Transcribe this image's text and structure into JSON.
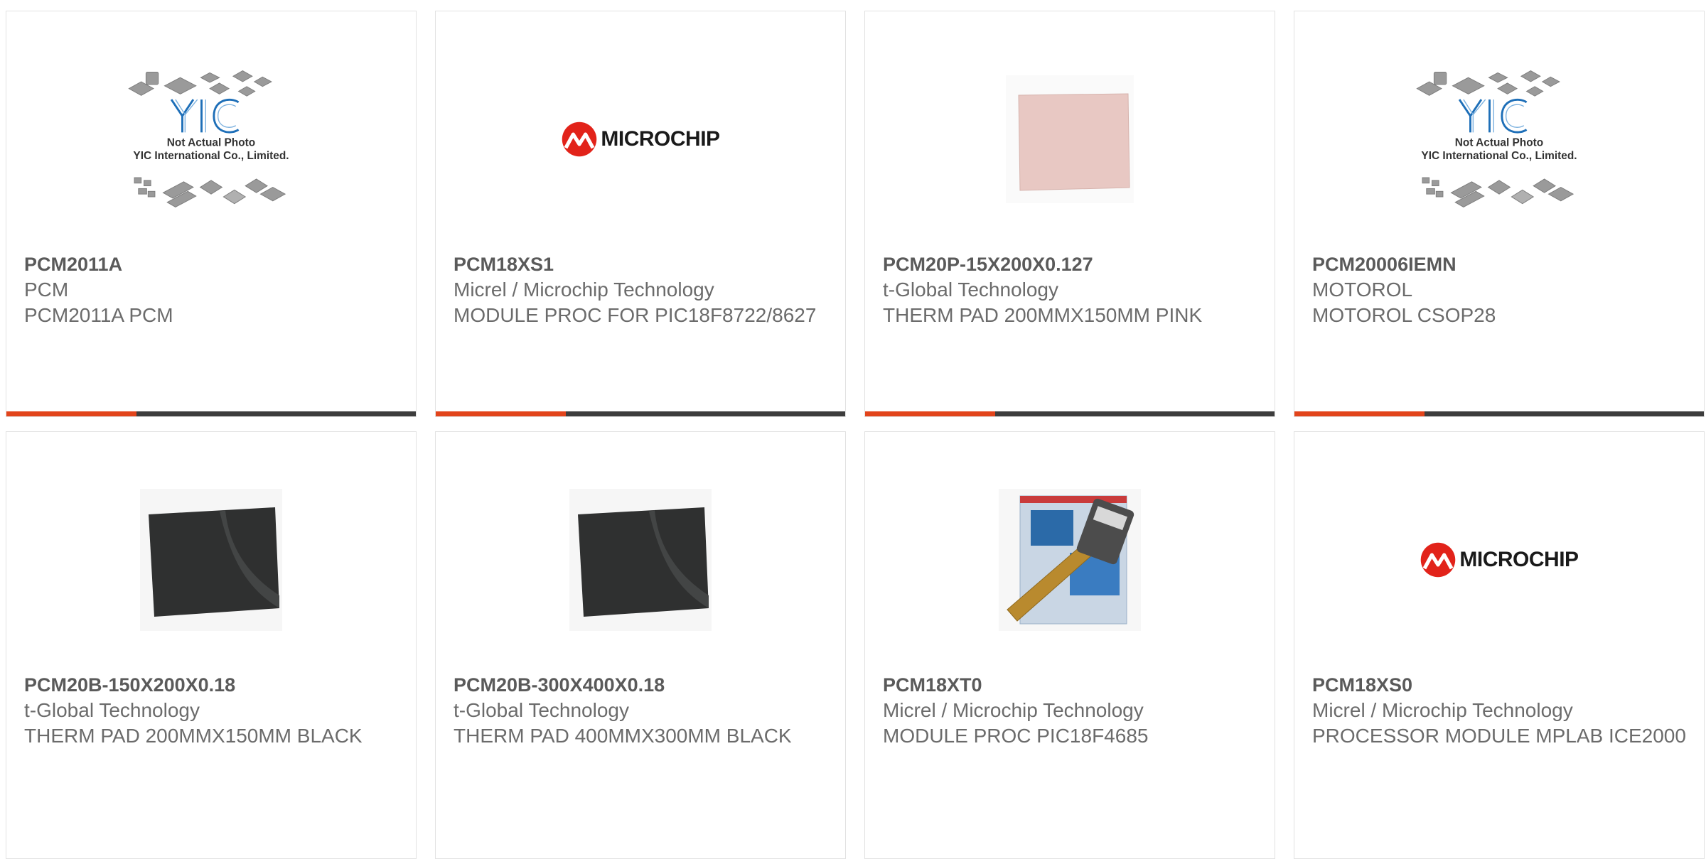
{
  "products": [
    {
      "part_number": "PCM2011A",
      "manufacturer": "PCM",
      "description": "PCM2011A PCM",
      "image": "yic-placeholder",
      "image_caption_1": "Not Actual Photo",
      "image_caption_2": "YIC International Co., Limited."
    },
    {
      "part_number": "PCM18XS1",
      "manufacturer": "Micrel / Microchip Technology",
      "description": "MODULE PROC FOR PIC18F8722/8627",
      "image": "microchip-logo",
      "logo_text": "MICROCHIP"
    },
    {
      "part_number": "PCM20P-15X200X0.127",
      "manufacturer": "t-Global Technology",
      "description": "THERM PAD 200MMX150MM PINK",
      "image": "pink-thermal-pad"
    },
    {
      "part_number": "PCM20006IEMN",
      "manufacturer": "MOTOROL",
      "description": "MOTOROL CSOP28",
      "image": "yic-placeholder",
      "image_caption_1": "Not Actual Photo",
      "image_caption_2": "YIC International Co., Limited."
    },
    {
      "part_number": "PCM20B-150X200X0.18",
      "manufacturer": "t-Global Technology",
      "description": "THERM PAD 200MMX150MM BLACK",
      "image": "black-thermal-pad"
    },
    {
      "part_number": "PCM20B-300X400X0.18",
      "manufacturer": "t-Global Technology",
      "description": "THERM PAD 400MMX300MM BLACK",
      "image": "black-thermal-pad"
    },
    {
      "part_number": "PCM18XT0",
      "manufacturer": "Micrel / Microchip Technology",
      "description": "MODULE PROC PIC18F4685",
      "image": "processor-module-photo"
    },
    {
      "part_number": "PCM18XS0",
      "manufacturer": "Micrel / Microchip Technology",
      "description": "PROCESSOR MODULE MPLAB ICE2000",
      "image": "microchip-logo",
      "logo_text": "MICROCHIP"
    }
  ],
  "colors": {
    "accent": "#e2441b",
    "bar": "#3d3d3d",
    "text": "#6b6b6b",
    "microchip_red": "#e2231a"
  }
}
